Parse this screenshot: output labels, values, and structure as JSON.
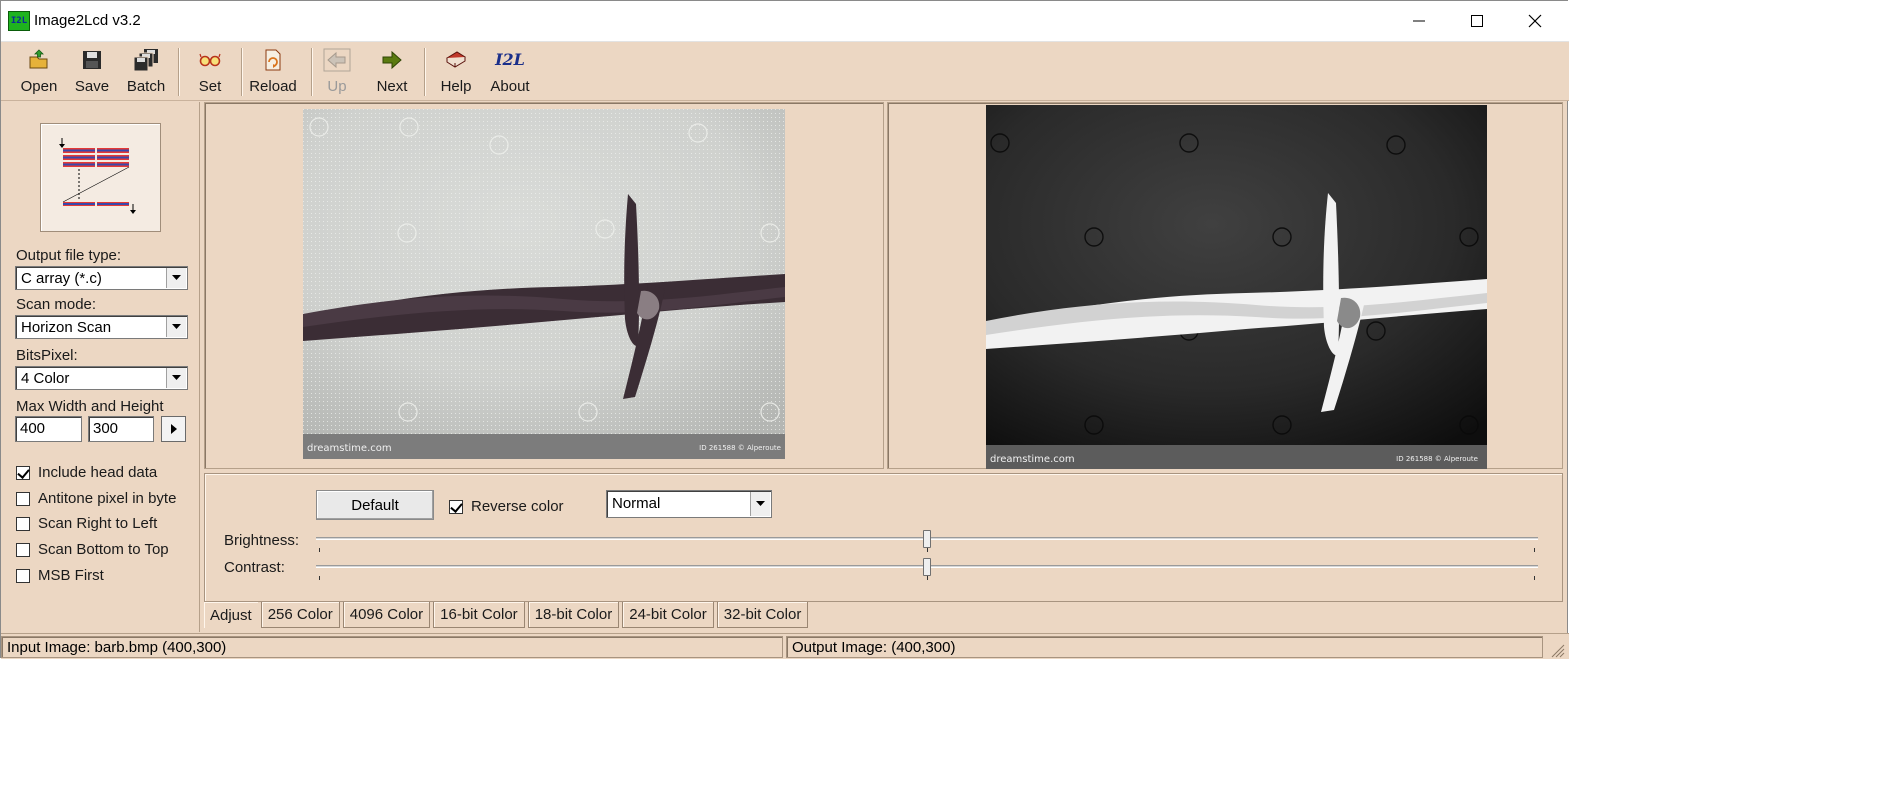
{
  "window": {
    "title": "Image2Lcd v3.2",
    "app_icon_text": "I2L"
  },
  "toolbar": {
    "open": "Open",
    "save": "Save",
    "batch": "Batch",
    "set": "Set",
    "reload": "Reload",
    "up": "Up",
    "next": "Next",
    "help": "Help",
    "about": "About",
    "about_icon_text": "I2L"
  },
  "settings": {
    "output_file_type_label": "Output file type:",
    "output_file_type_value": "C array (*.c)",
    "scan_mode_label": "Scan mode:",
    "scan_mode_value": "Horizon Scan",
    "bits_pixel_label": "BitsPixel:",
    "bits_pixel_value": "4 Color",
    "max_size_label": "Max Width and Height",
    "max_width": "400",
    "max_height": "300",
    "checkboxes": [
      {
        "label": "Include head data",
        "checked": true
      },
      {
        "label": "Antitone pixel in byte",
        "checked": false
      },
      {
        "label": "Scan Right to Left",
        "checked": false
      },
      {
        "label": "Scan Bottom to Top",
        "checked": false
      },
      {
        "label": "MSB First",
        "checked": false
      }
    ]
  },
  "images": {
    "input_watermark": "dreamstime.com",
    "input_id": "ID 261588 © Alperoute",
    "output_watermark": "dreamstime.com",
    "output_id": "ID 261588 © Alperoute"
  },
  "adjust": {
    "default_button": "Default",
    "reverse_color_label": "Reverse color",
    "reverse_color_checked": true,
    "mode_value": "Normal",
    "brightness_label": "Brightness:",
    "contrast_label": "Contrast:",
    "brightness_value": 0.5,
    "contrast_value": 0.5
  },
  "tabs": [
    "Adjust",
    "256 Color",
    "4096 Color",
    "16-bit Color",
    "18-bit Color",
    "24-bit Color",
    "32-bit Color"
  ],
  "status": {
    "input": "Input Image: barb.bmp (400,300)",
    "output": "Output Image: (400,300)"
  },
  "colors": {
    "window_bg": "#ecd7c3",
    "app_icon_bg": "#1fb31f"
  }
}
